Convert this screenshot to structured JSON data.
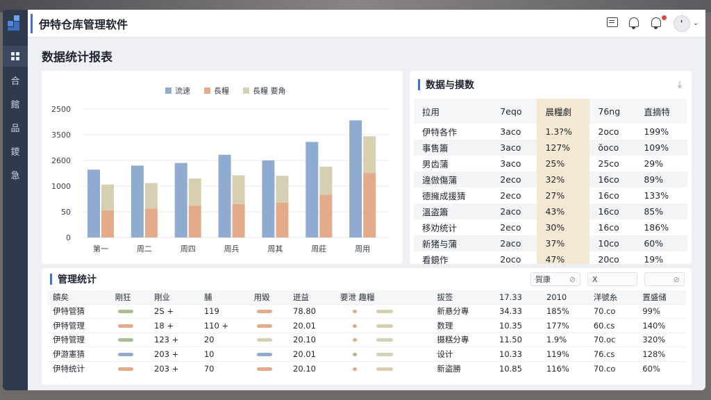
{
  "app": {
    "title": "伊特仓库管理软件"
  },
  "sidebar": {
    "items": [
      {
        "icon": "dashboard-icon",
        "label": ""
      },
      {
        "label": "合"
      },
      {
        "label": "館"
      },
      {
        "label": "品"
      },
      {
        "label": "鑁"
      },
      {
        "label": "急"
      }
    ]
  },
  "page": {
    "title": "数据统计报表"
  },
  "chart": {
    "legend": [
      "流速",
      "長糧",
      "長糧  要角"
    ],
    "yticks": [
      "2500",
      "3500",
      "2600",
      "1000",
      "50",
      "0"
    ]
  },
  "chart_data": {
    "type": "bar",
    "categories": [
      "第一",
      "周二",
      "周四",
      "周兵",
      "周其",
      "周莊",
      "周用"
    ],
    "series": [
      {
        "name": "流速",
        "values": [
          1320,
          1400,
          1450,
          1610,
          1500,
          1860,
          2280
        ]
      },
      {
        "name": "長糧",
        "values": [
          530,
          560,
          620,
          650,
          680,
          830,
          1250
        ]
      },
      {
        "name": "長糧  要角",
        "values": [
          500,
          500,
          530,
          560,
          520,
          550,
          720
        ]
      }
    ],
    "colors": [
      "#8fabcf",
      "#e3ab8a",
      "#d6cfb2"
    ],
    "ylim": [
      0,
      2500
    ]
  },
  "stats_table": {
    "title": "数据与摸数",
    "columns": [
      "拉用",
      "7eqo",
      "晨糧劇",
      "76ng",
      "直摘特"
    ],
    "rows": [
      [
        "伊特各作",
        "3aco",
        "1.3?%",
        "2oco",
        "199%"
      ],
      [
        "事售簫",
        "3aco",
        "127%",
        "ŏoco",
        "109%"
      ],
      [
        "男齿蒲",
        "3aco",
        "25%",
        "25co",
        "29%"
      ],
      [
        "違倣傷蒲",
        "2eco",
        "32%",
        "16co",
        "89%"
      ],
      [
        "德擁成援猜",
        "2eco",
        "27%",
        "16co",
        "133%"
      ],
      [
        "溫盗簫",
        "2aco",
        "43%",
        "16co",
        "85%"
      ],
      [
        "移劝统计",
        "2eco",
        "30%",
        "16co",
        "186%"
      ],
      [
        "新猪与蒲",
        "2aco",
        "37%",
        "10co",
        "60%"
      ],
      [
        "看鏡作",
        "2oco",
        "47%",
        "20co",
        "19%"
      ]
    ]
  },
  "mgmt": {
    "title": "管理统计",
    "filters": [
      {
        "label": "賀康",
        "suffix": "⊘"
      },
      {
        "label": "X",
        "suffix": ""
      },
      {
        "label": "",
        "suffix": "⊘"
      }
    ],
    "columns": [
      "饋矣",
      "剛狂",
      "剛业",
      "脯",
      "用毀",
      "迸益",
      "要泄 趣糧",
      "拔签",
      "17.33",
      "2010",
      "洋號糸",
      "置盛储"
    ],
    "rows": [
      [
        "伊特管猜",
        "",
        "2S +",
        "119",
        "",
        "78.80",
        "",
        "新悬分專",
        "34.33",
        "185%",
        "70.co",
        "99%"
      ],
      [
        "伊特管理",
        "",
        "18 +",
        "110 +",
        "",
        "20.01",
        "",
        "数理",
        "10.35",
        "177%",
        "60.cs",
        "140%"
      ],
      [
        "伊特管理",
        "",
        "123 +",
        "20",
        "",
        "20.10",
        "",
        "摄糕分專",
        "11.50",
        "1.9%",
        "70.oc",
        "320%"
      ],
      [
        "伊游憲猜",
        "",
        "203 +",
        "10",
        "",
        "20.01",
        "",
        "设计",
        "10.33",
        "119%",
        "76.cs",
        "128%"
      ],
      [
        "伊特统计",
        "",
        "203 +",
        "70",
        "",
        "20.10",
        "",
        "新盗勝",
        "10.85",
        "116%",
        "70.co",
        "60%"
      ]
    ],
    "pill_colors": {
      "green": "#a7be8f",
      "salmon": "#e3ab8a",
      "blue": "#8fabcf",
      "beige": "#d6cfb2"
    }
  }
}
